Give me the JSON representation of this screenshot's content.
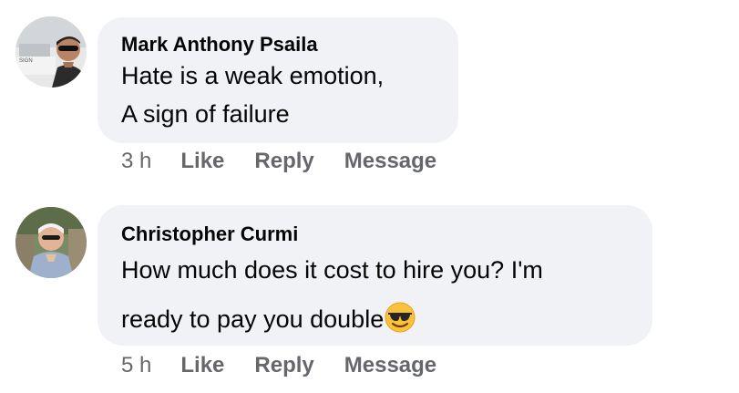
{
  "comments": [
    {
      "author": "Mark Anthony Psaila",
      "lines": [
        "Hate is a weak emotion,",
        "A sign of failure"
      ],
      "time": "3 h",
      "like_label": "Like",
      "reply_label": "Reply",
      "message_label": "Message",
      "avatar_icon": "profile-photo-sunglasses-man"
    },
    {
      "author": "Christopher Curmi",
      "lines": [
        "How much does it cost to hire you? I'm",
        "ready to pay you double"
      ],
      "time": "5 h",
      "like_label": "Like",
      "reply_label": "Reply",
      "message_label": "Message",
      "avatar_icon": "profile-photo-white-haired-man",
      "trailing_emoji": "smiling-face-with-sunglasses-emoji"
    }
  ],
  "colors": {
    "bubble_bg": "#f0f2f5",
    "text": "#050505",
    "secondary_text": "#65676b"
  }
}
